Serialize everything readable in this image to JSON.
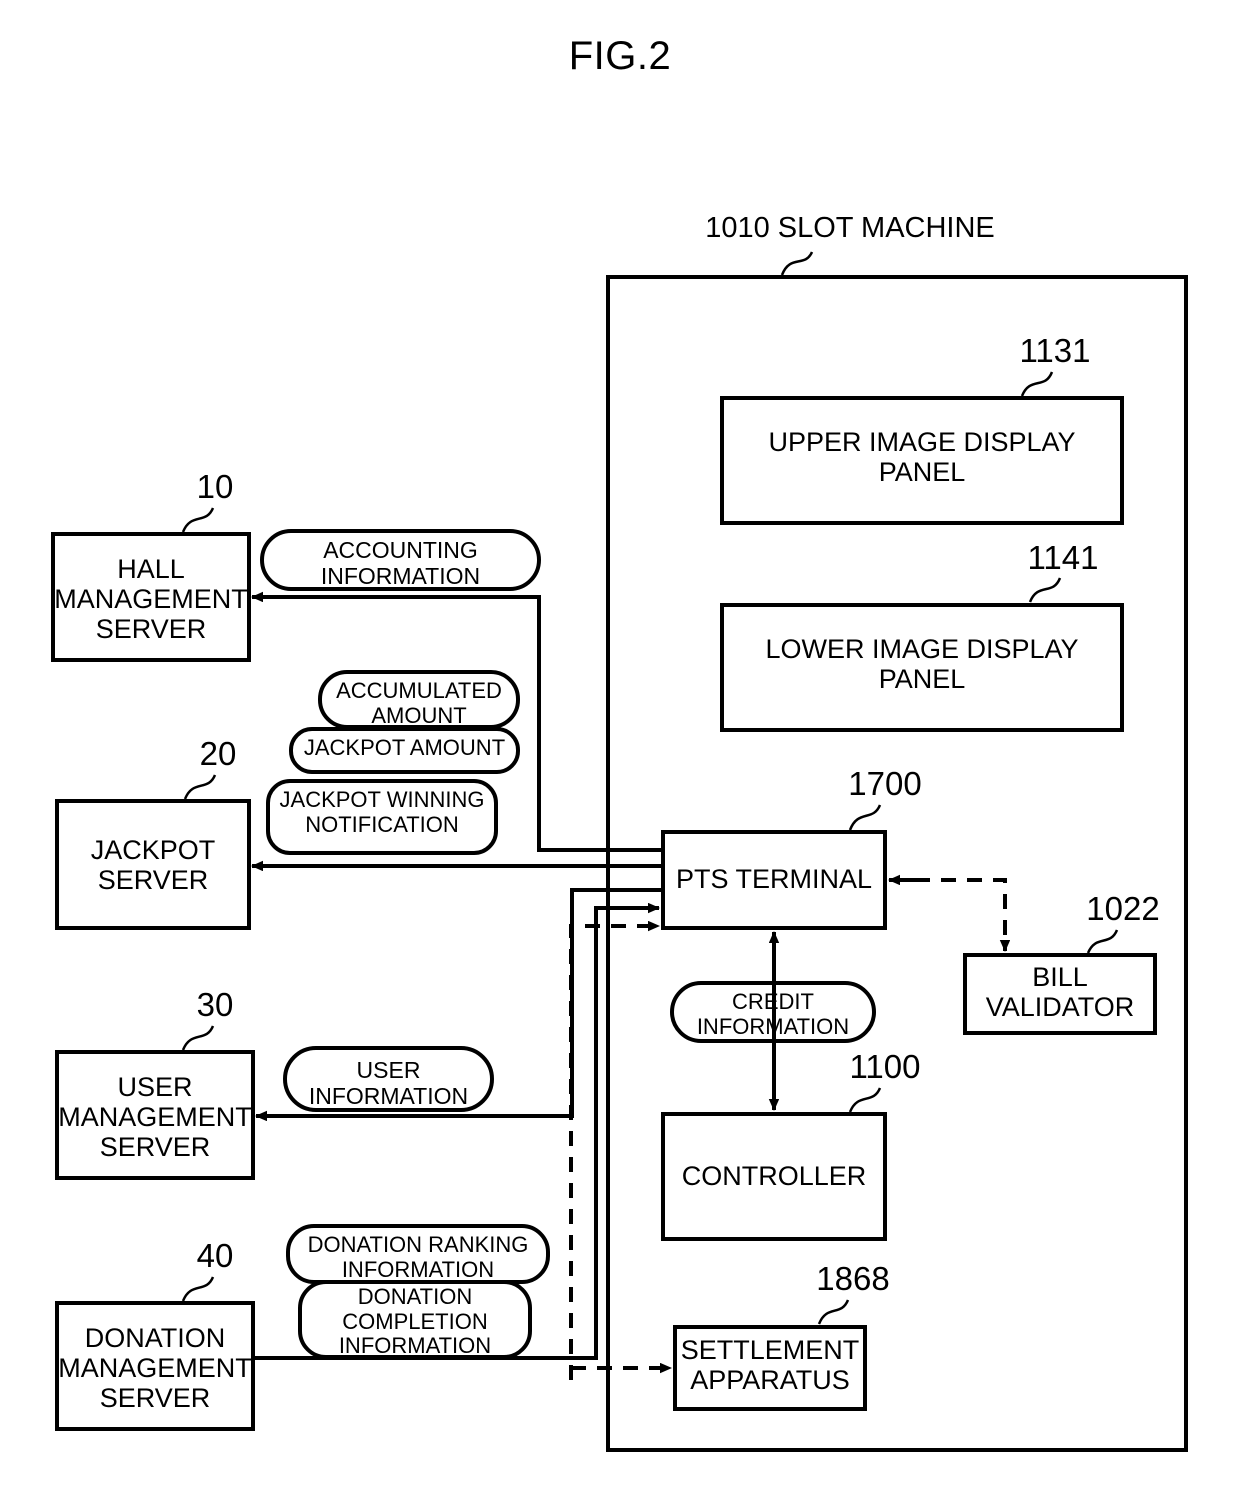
{
  "figure": {
    "title": "FIG.2",
    "machine_caption": "1010 SLOT MACHINE"
  },
  "boxes": {
    "hall_management_server": {
      "label": "HALL\nMANAGEMENT\nSERVER",
      "ref": "10"
    },
    "jackpot_server": {
      "label": "JACKPOT\nSERVER",
      "ref": "20"
    },
    "user_management_server": {
      "label": "USER\nMANAGEMENT\nSERVER",
      "ref": "30"
    },
    "donation_management_server": {
      "label": "DONATION\nMANAGEMENT\nSERVER",
      "ref": "40"
    },
    "upper_image_display_panel": {
      "label": "UPPER IMAGE DISPLAY\nPANEL",
      "ref": "1131"
    },
    "lower_image_display_panel": {
      "label": "LOWER IMAGE DISPLAY\nPANEL",
      "ref": "1141"
    },
    "pts_terminal": {
      "label": "PTS TERMINAL",
      "ref": "1700"
    },
    "bill_validator": {
      "label": "BILL\nVALIDATOR",
      "ref": "1022"
    },
    "controller": {
      "label": "CONTROLLER",
      "ref": "1100"
    },
    "settlement_apparatus": {
      "label": "SETTLEMENT\nAPPARATUS",
      "ref": "1868"
    }
  },
  "signal_labels": {
    "accounting_information": "ACCOUNTING\nINFORMATION",
    "accumulated_amount": "ACCUMULATED\nAMOUNT",
    "jackpot_amount": "JACKPOT AMOUNT",
    "jackpot_winning_notification": "JACKPOT WINNING\nNOTIFICATION",
    "user_information": "USER\nINFORMATION",
    "donation_ranking_information": "DONATION RANKING\nINFORMATION",
    "donation_completion_information": "DONATION\nCOMPLETION\nINFORMATION",
    "credit_information": "CREDIT\nINFORMATION"
  },
  "colors": {
    "ink": "#000000",
    "paper": "#ffffff"
  }
}
